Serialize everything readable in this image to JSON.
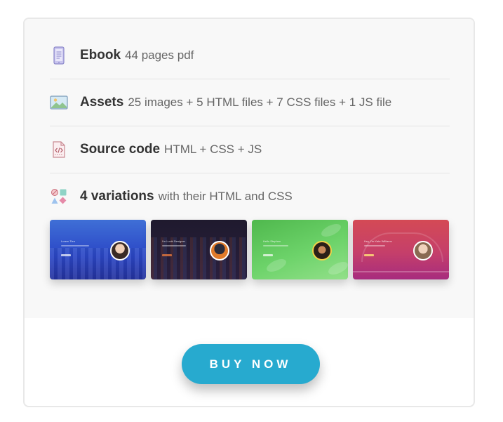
{
  "items": [
    {
      "icon": "ebook-phone-icon",
      "label": "Ebook",
      "desc": "44 pages pdf"
    },
    {
      "icon": "image-assets-icon",
      "label": "Assets",
      "desc": "25 images + 5 HTML files + 7 CSS files + 1 JS file"
    },
    {
      "icon": "code-file-icon",
      "label": "Source code",
      "desc": "HTML + CSS + JS"
    },
    {
      "icon": "shapes-icon",
      "label": "4 variations",
      "desc": "with their HTML and CSS"
    }
  ],
  "variations": [
    {
      "name": "Lorem Tien"
    },
    {
      "name": "I'm Lucid Designer"
    },
    {
      "name": "Hello Stephen"
    },
    {
      "name": "Hey, I'm Kate Williams"
    }
  ],
  "buy_label": "BUY NOW",
  "colors": {
    "accent": "#27aacf",
    "panel_bg": "#f8f8f8",
    "text_dark": "#333333",
    "text_muted": "#666666"
  }
}
